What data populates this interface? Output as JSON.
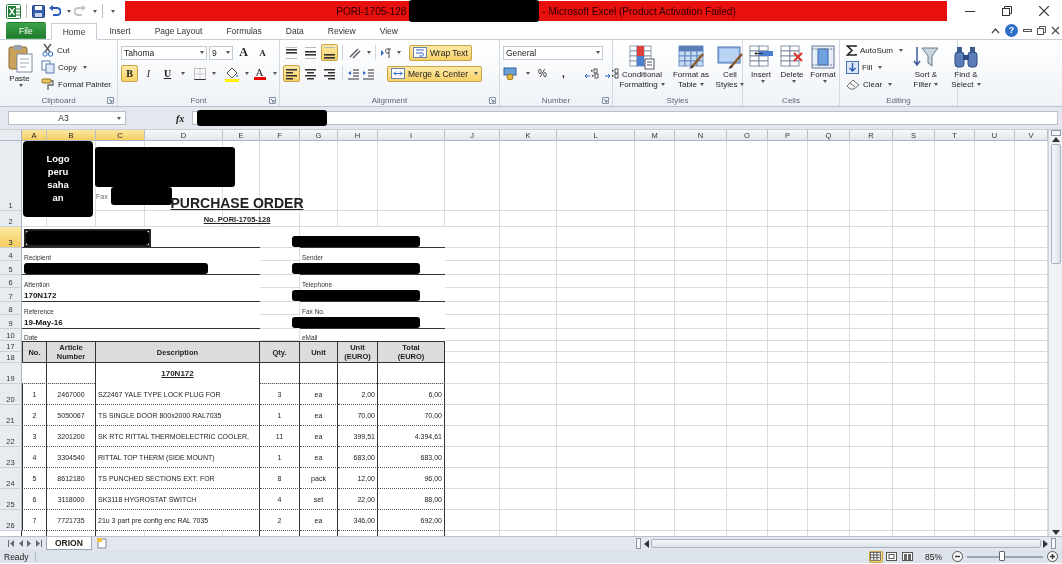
{
  "window": {
    "document_title": "PORI-1705-128",
    "app_title": "- Microsoft Excel (Product Activation Failed)"
  },
  "quick_access": [
    {
      "kind": "save",
      "disabled": false
    },
    {
      "kind": "undo",
      "disabled": false
    },
    {
      "kind": "redo",
      "disabled": true
    }
  ],
  "ribbon_tabs": [
    {
      "label": "File",
      "kind": "file",
      "selected": false
    },
    {
      "label": "Home",
      "kind": "tab",
      "selected": true
    },
    {
      "label": "Insert",
      "kind": "tab",
      "selected": false
    },
    {
      "label": "Page Layout",
      "kind": "tab",
      "selected": false
    },
    {
      "label": "Formulas",
      "kind": "tab",
      "selected": false
    },
    {
      "label": "Data",
      "kind": "tab",
      "selected": false
    },
    {
      "label": "Review",
      "kind": "tab",
      "selected": false
    },
    {
      "label": "View",
      "kind": "tab",
      "selected": false
    }
  ],
  "help": "?",
  "ribbon": {
    "clipboard": {
      "label": "Clipboard",
      "paste": "Paste",
      "cut": "Cut",
      "copy": "Copy",
      "format_painter": "Format Painter"
    },
    "font": {
      "label": "Font",
      "font_name": "Tahoma",
      "font_size": "9",
      "grow_font": "A",
      "shrink_font": "A",
      "bold": {
        "text": "B",
        "selected": true
      },
      "italic": {
        "text": "I",
        "selected": false
      },
      "underline": {
        "text": "U",
        "selected": false
      },
      "font_color": "A"
    },
    "alignment": {
      "label": "Alignment",
      "vertical": [
        {
          "kind": "top",
          "selected": false
        },
        {
          "kind": "middle",
          "selected": false
        },
        {
          "kind": "bottom",
          "selected": true
        }
      ],
      "horizontal": [
        {
          "kind": "left",
          "selected": true
        },
        {
          "kind": "center",
          "selected": false
        },
        {
          "kind": "right",
          "selected": false
        }
      ],
      "wrap_text": {
        "label": "Wrap Text",
        "selected": true
      },
      "merge_center": {
        "label": "Merge & Center",
        "selected": true
      }
    },
    "number": {
      "label": "Number",
      "format": "General",
      "percent": "%",
      "comma": ","
    },
    "styles": {
      "label": "Styles",
      "buttons": [
        {
          "label": "Conditional Formatting",
          "kind": "conditional"
        },
        {
          "label": "Format as Table",
          "kind": "table"
        },
        {
          "label": "Cell Styles",
          "kind": "cell_styles"
        }
      ]
    },
    "cells": {
      "label": "Cells",
      "buttons": [
        {
          "label": "Insert",
          "kind": "insert"
        },
        {
          "label": "Delete",
          "kind": "delete"
        },
        {
          "label": "Format",
          "kind": "format"
        }
      ]
    },
    "editing": {
      "label": "Editing",
      "small": [
        {
          "label": "AutoSum",
          "kind": "autosum"
        },
        {
          "label": "Fill",
          "kind": "fill"
        },
        {
          "label": "Clear",
          "kind": "clear"
        }
      ],
      "large": [
        {
          "label": "Sort & Filter",
          "kind": "sort"
        },
        {
          "label": "Find & Select",
          "kind": "find"
        }
      ]
    }
  },
  "formula_bar": {
    "name_box": "A3",
    "function_label": "fx"
  },
  "sheet": {
    "columns": [
      {
        "label": "A",
        "selected": true
      },
      {
        "label": "B",
        "selected": true
      },
      {
        "label": "C",
        "selected": true
      },
      {
        "label": "D",
        "selected": false
      },
      {
        "label": "E",
        "selected": false
      },
      {
        "label": "F",
        "selected": false
      },
      {
        "label": "G",
        "selected": false
      },
      {
        "label": "H",
        "selected": false
      },
      {
        "label": "I",
        "selected": false
      },
      {
        "label": "J",
        "selected": false
      },
      {
        "label": "K",
        "selected": false
      },
      {
        "label": "L",
        "selected": false
      },
      {
        "label": "M",
        "selected": false
      },
      {
        "label": "N",
        "selected": false
      },
      {
        "label": "O",
        "selected": false
      },
      {
        "label": "P",
        "selected": false
      },
      {
        "label": "Q",
        "selected": false
      },
      {
        "label": "R",
        "selected": false
      },
      {
        "label": "S",
        "selected": false
      },
      {
        "label": "T",
        "selected": false
      },
      {
        "label": "U",
        "selected": false
      },
      {
        "label": "V",
        "selected": false
      }
    ],
    "rows": [
      {
        "label": "1",
        "selected": false
      },
      {
        "label": "2",
        "selected": false
      },
      {
        "label": "3",
        "selected": true
      },
      {
        "label": "4",
        "selected": false
      },
      {
        "label": "5",
        "selected": false
      },
      {
        "label": "6",
        "selected": false
      },
      {
        "label": "7",
        "selected": false
      },
      {
        "label": "8",
        "selected": false
      },
      {
        "label": "9",
        "selected": false
      },
      {
        "label": "10",
        "selected": false
      },
      {
        "label": "17",
        "selected": false
      },
      {
        "label": "18",
        "selected": false
      },
      {
        "label": "19",
        "selected": false
      },
      {
        "label": "20",
        "selected": false
      },
      {
        "label": "21",
        "selected": false
      },
      {
        "label": "22",
        "selected": false
      },
      {
        "label": "23",
        "selected": false
      },
      {
        "label": "24",
        "selected": false
      },
      {
        "label": "25",
        "selected": false
      },
      {
        "label": "26",
        "selected": false
      }
    ],
    "logo": "Logo peru saha an",
    "fax_label": "Fax",
    "title": "PURCHASE ORDER",
    "order_number": "No. PORI-1705-128",
    "info_left": [
      {
        "kind": "redacted"
      },
      {
        "kind": "label",
        "text": "Recipient"
      },
      {
        "kind": "redacted"
      },
      {
        "kind": "label",
        "text": "Attention"
      },
      {
        "kind": "value",
        "text": "170N172"
      },
      {
        "kind": "label",
        "text": "Reference"
      },
      {
        "kind": "value",
        "text": "19-May-16"
      },
      {
        "kind": "label",
        "text": "Date"
      }
    ],
    "info_right": [
      {
        "kind": "redacted"
      },
      {
        "kind": "label",
        "text": "Sender"
      },
      {
        "kind": "redacted"
      },
      {
        "kind": "label",
        "text": "Telephone"
      },
      {
        "kind": "redacted"
      },
      {
        "kind": "label",
        "text": "Fax No."
      },
      {
        "kind": "redacted"
      },
      {
        "kind": "label",
        "text": "eMail"
      }
    ],
    "table": {
      "columns": [
        "No.",
        "Article Number",
        "Description",
        "Qty.",
        "Unit",
        "Unit (EURO)",
        "Total (EURO)"
      ],
      "group_heading": "170N172",
      "rows": [
        {
          "no": "1",
          "article": "2467000",
          "description": "SZ2467 YALE TYPE LOCK PLUG FOR",
          "qty": "3",
          "unit": "ea",
          "unit_price": "2,00",
          "total": "6,00"
        },
        {
          "no": "2",
          "article": "5050067",
          "description": "TS SINGLE DOOR 800x2000 RAL7035",
          "qty": "1",
          "unit": "ea",
          "unit_price": "70,00",
          "total": "70,00"
        },
        {
          "no": "3",
          "article": "3201200",
          "description": "SK RTC RITTAL THERMOELECTRIC COOLER,",
          "qty": "11",
          "unit": "ea",
          "unit_price": "399,51",
          "total": "4.394,61"
        },
        {
          "no": "4",
          "article": "3304540",
          "description": "RITTAL TOP THERM (SIDE MOUNT)",
          "qty": "1",
          "unit": "ea",
          "unit_price": "683,00",
          "total": "683,00"
        },
        {
          "no": "5",
          "article": "8612180",
          "description": "TS PUNCHED SECTIONS EXT. FOR",
          "qty": "8",
          "unit": "pack",
          "unit_price": "12,00",
          "total": "96,00"
        },
        {
          "no": "6",
          "article": "3118000",
          "description": "SK3118 HYGROSTAT SWITCH",
          "qty": "4",
          "unit": "set",
          "unit_price": "22,00",
          "total": "88,00"
        },
        {
          "no": "7",
          "article": "7721735",
          "description": "21u 3 part pre config enc RAL 7035",
          "qty": "2",
          "unit": "ea",
          "unit_price": "346,00",
          "total": "692,00"
        }
      ]
    }
  },
  "sheet_tabs": [
    {
      "label": "ORION",
      "selected": true
    }
  ],
  "status_bar": {
    "mode": "Ready",
    "views": [
      {
        "kind": "normal",
        "selected": true
      },
      {
        "kind": "page_layout",
        "selected": false
      },
      {
        "kind": "page_break",
        "selected": false
      }
    ],
    "zoom": "85%",
    "zoom_slider": {
      "level": 0.46
    }
  }
}
